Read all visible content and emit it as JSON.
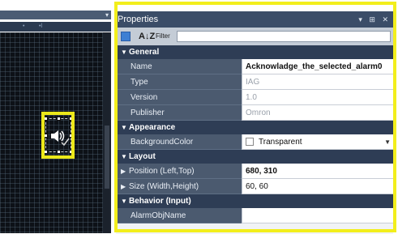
{
  "designer": {
    "dropdown_glyph": "▾",
    "ruler_marks": [
      "•",
      "•l"
    ],
    "widget_icon": "speaker-check-icon"
  },
  "properties": {
    "title": "Properties",
    "window_controls": "▾ ⊞ ✕",
    "toolbar": {
      "sort_glyph": "A↓Z",
      "filter_label": "Filter",
      "filter_value": ""
    },
    "categories": {
      "general": "General",
      "appearance": "Appearance",
      "layout": "Layout",
      "behavior": "Behavior (Input)"
    },
    "rows": {
      "name": {
        "label": "Name",
        "value": "Acknowladge_the_selected_alarm0"
      },
      "type": {
        "label": "Type",
        "value": "IAG"
      },
      "version": {
        "label": "Version",
        "value": "1.0"
      },
      "publisher": {
        "label": "Publisher",
        "value": "Omron"
      },
      "bgcolor": {
        "label": "BackgroundColor",
        "value": "Transparent"
      },
      "position": {
        "label": "Position (Left,Top)",
        "value": "680, 310"
      },
      "size": {
        "label": "Size (Width,Height)",
        "value": "60, 60"
      },
      "alarmobj": {
        "label": "AlarmObjName",
        "value": ""
      }
    }
  },
  "colors": {
    "highlight": "#f2ee1c",
    "panel_title_bg": "#3b4d68",
    "category_bg": "#2e3d55",
    "label_bg": "#4b5a6f"
  }
}
